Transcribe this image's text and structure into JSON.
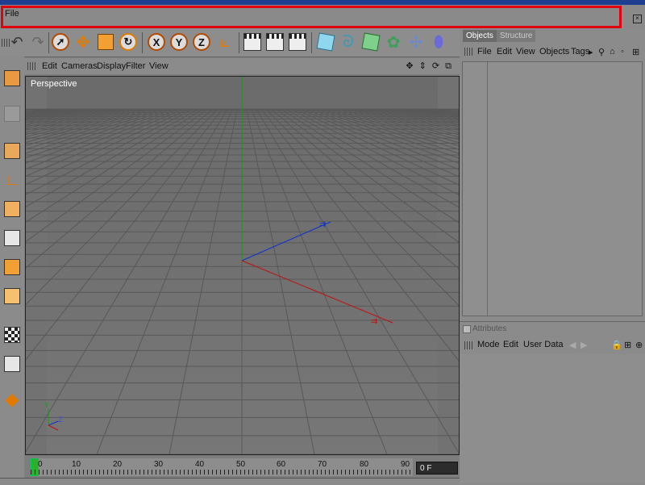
{
  "menubar": {
    "file_label": "File"
  },
  "toolbar": {
    "undo_icon": "undo-icon",
    "axis_x_label": "X",
    "axis_y_label": "Y",
    "axis_z_label": "Z"
  },
  "viewport_menu": {
    "items": [
      "Edit",
      "Cameras",
      "Display",
      "Filter",
      "View"
    ],
    "nav_glyphs": "✥ ⇕ ⟳ ⧉"
  },
  "viewport": {
    "label": "Perspective",
    "axis_y": "Y",
    "axis_z": "Z"
  },
  "timeline": {
    "ticks": [
      "0",
      "10",
      "20",
      "30",
      "40",
      "50",
      "60",
      "70",
      "80",
      "90"
    ],
    "frame_value": "0 F"
  },
  "objects_panel": {
    "tabs": [
      "Objects",
      "Structure"
    ],
    "menu": [
      "File",
      "Edit",
      "View",
      "Objects",
      "Tags"
    ]
  },
  "attributes_panel": {
    "title": "Attributes",
    "menu": [
      "Mode",
      "Edit",
      "User Data"
    ]
  },
  "colors": {
    "highlight": "#e00010",
    "x_axis": "#c01010",
    "y_axis": "#10a010",
    "z_axis": "#1030d0"
  }
}
